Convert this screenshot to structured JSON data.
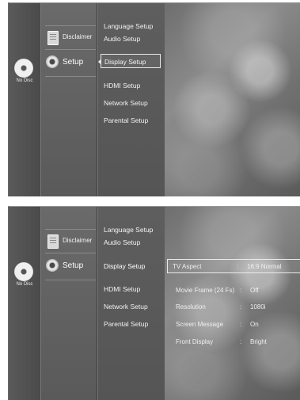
{
  "no_disc_label": "No Disc",
  "main_menu": [
    {
      "label": "Disclaimer"
    },
    {
      "label": "Setup"
    }
  ],
  "setup_menu": [
    {
      "label": "Language Setup"
    },
    {
      "label": "Audio Setup"
    },
    {
      "label": "Display Setup"
    },
    {
      "label": "HDMI Setup"
    },
    {
      "label": "Network Setup"
    },
    {
      "label": "Parental Setup"
    }
  ],
  "display_setup": {
    "separator": ":",
    "options": [
      {
        "label": "TV Aspect",
        "value": "16:9 Normal"
      },
      {
        "label": "Movie Frame (24 Fs)",
        "value": "Off"
      },
      {
        "label": "Resolution",
        "value": "1080i"
      },
      {
        "label": "Screen Message",
        "value": "On"
      },
      {
        "label": "Front Display",
        "value": "Bright"
      }
    ]
  }
}
